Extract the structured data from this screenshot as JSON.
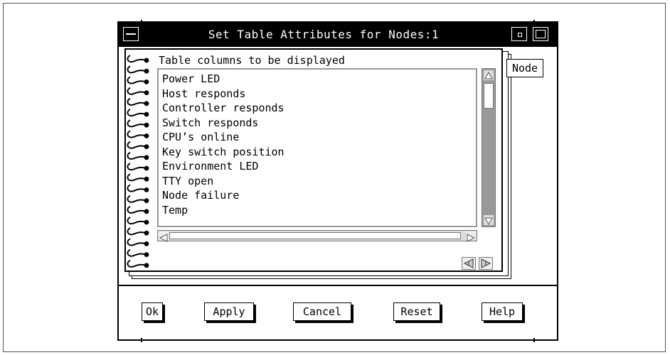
{
  "window": {
    "title": "Set Table Attributes for Nodes:1"
  },
  "notebook": {
    "heading": "Table columns to be displayed",
    "tab_label": "Node",
    "columns": [
      "Power LED",
      "Host responds",
      "Controller responds",
      "Switch responds",
      "CPU’s online",
      "Key switch position",
      "Environment LED",
      "TTY open",
      "Node failure",
      "Temp"
    ]
  },
  "buttons": {
    "ok": "Ok",
    "apply": "Apply",
    "cancel": "Cancel",
    "reset": "Reset",
    "help": "Help"
  },
  "icons": {
    "system_menu": "window-menu-icon",
    "minimize": "minimize-icon",
    "maximize": "maximize-icon",
    "spiral": "notebook-spiral-binding",
    "page_back": "page-back-icon",
    "page_forward": "page-forward-icon"
  }
}
